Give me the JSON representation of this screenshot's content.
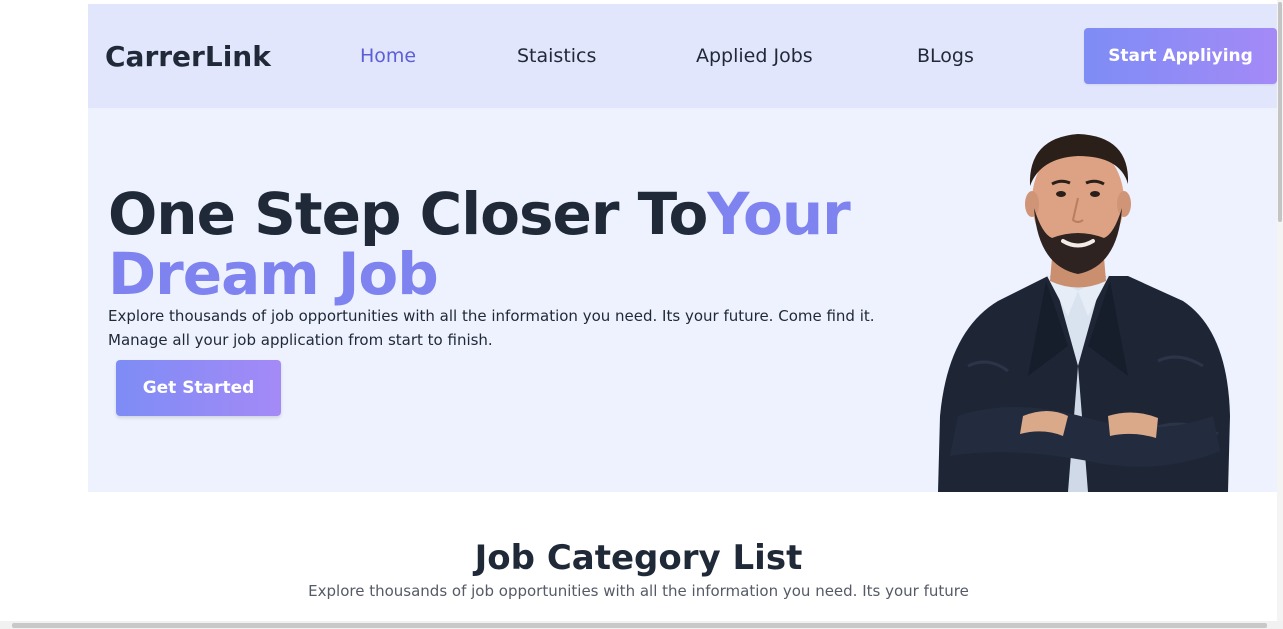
{
  "navbar": {
    "brand": "CarrerLink",
    "links": [
      {
        "label": "Home",
        "active": true
      },
      {
        "label": "Staistics",
        "active": false
      },
      {
        "label": "Applied Jobs",
        "active": false
      },
      {
        "label": "BLogs",
        "active": false
      }
    ],
    "cta_label": "Start Appliying"
  },
  "hero": {
    "title_dark": "One Step Closer To",
    "title_accent": "Your Dream Job",
    "description_line1": "Explore thousands of job opportunities with all the information you need. Its your future. Come find it.",
    "description_line2": "Manage all your job application from start to finish.",
    "button_label": "Get Started",
    "image_alt": "Smiling man in dark blazer with arms crossed"
  },
  "category_section": {
    "title": "Job Category List",
    "subtitle": "Explore thousands of job opportunities with all the information you need. Its your future"
  },
  "colors": {
    "accent": "#7e83f0",
    "active_link": "#5b5fd6",
    "navbar_bg": "#e2e6fd",
    "hero_bg": "#eef1fe",
    "text_dark": "#1f2937"
  }
}
